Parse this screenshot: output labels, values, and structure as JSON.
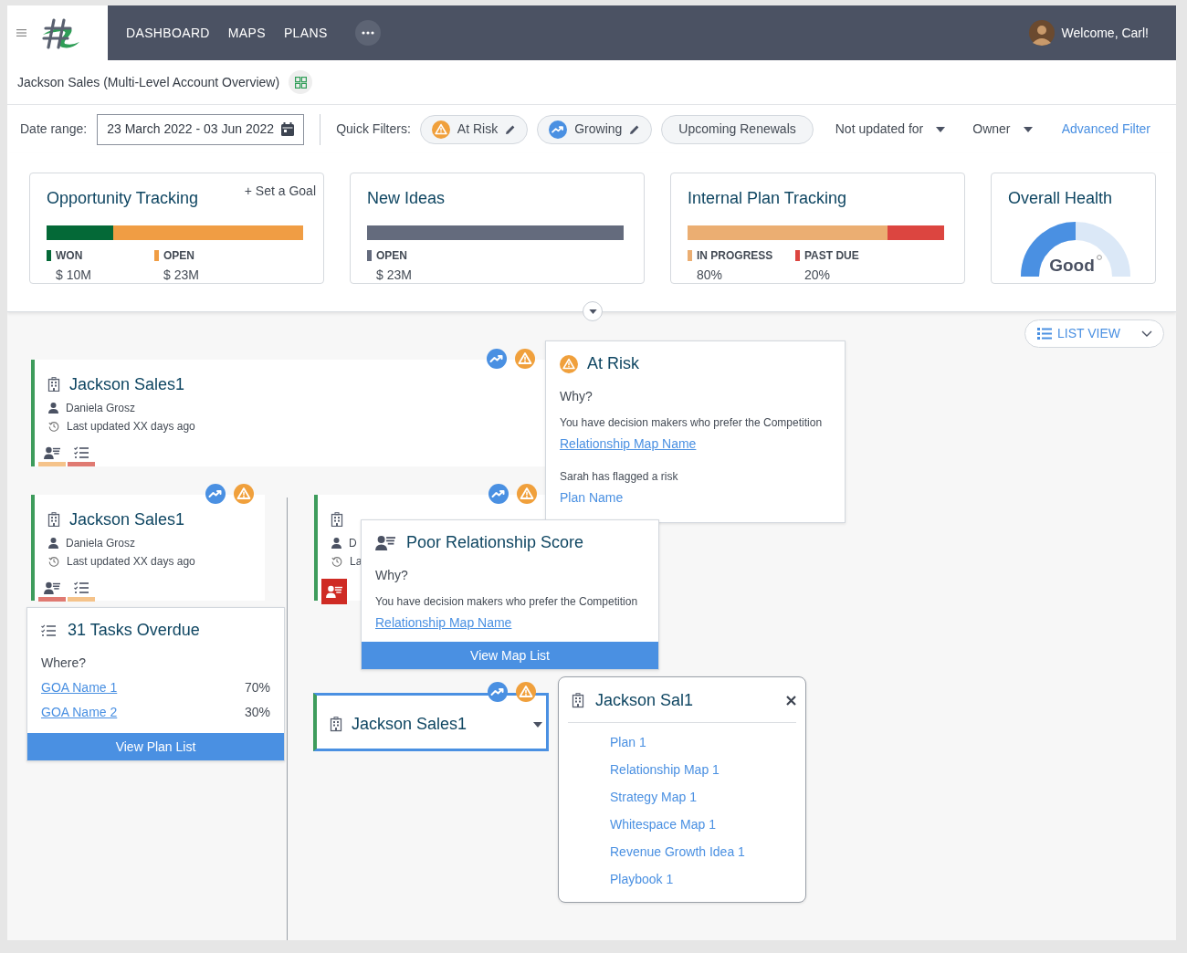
{
  "header": {
    "nav": [
      "DASHBOARD",
      "MAPS",
      "PLANS"
    ],
    "welcome": "Welcome, Carl!"
  },
  "page_title": "Jackson Sales (Multi-Level Account Overview)",
  "filters": {
    "date_label": "Date range:",
    "date_value": "23 March 2022 - 03 Jun 2022",
    "quick_label": "Quick Filters:",
    "quick": [
      {
        "label": "At Risk",
        "kind": "risk",
        "editable": true
      },
      {
        "label": "Growing",
        "kind": "growth",
        "editable": true
      },
      {
        "label": "Upcoming Renewals",
        "kind": "plain",
        "editable": false
      }
    ],
    "dropdowns": [
      "Not updated for",
      "Owner"
    ],
    "advanced": "Advanced Filter"
  },
  "summary_cards": [
    {
      "kind": "bar",
      "title": "Opportunity Tracking",
      "action": "+ Set a Goal",
      "segments": [
        {
          "label": "WON",
          "value": "$ 10M",
          "color": "#046937"
        },
        {
          "label": "OPEN",
          "value": "$ 23M",
          "color": "#f09d44"
        }
      ]
    },
    {
      "kind": "bar",
      "title": "New Ideas",
      "segments": [
        {
          "label": "OPEN",
          "value": "$ 23M",
          "color": "#646b7d"
        }
      ]
    },
    {
      "kind": "bar",
      "title": "Internal Plan Tracking",
      "segments": [
        {
          "label": "IN PROGRESS",
          "value": "80%",
          "color": "#ebae72"
        },
        {
          "label": "PAST DUE",
          "value": "20%",
          "color": "#dc4540"
        }
      ]
    },
    {
      "kind": "gauge",
      "title": "Overall Health",
      "value": "Good"
    }
  ],
  "view_switch": "LIST VIEW",
  "nodes": [
    {
      "kind": "full",
      "selected": false,
      "title": "Jackson Sales1",
      "owner": "Daniela Grosz",
      "updated": "Last updated XX days ago",
      "indicators": [
        {
          "kind": "relationship",
          "color": "#f5c38a",
          "active": false
        },
        {
          "kind": "tasks",
          "color": "#e07a72",
          "active": false
        }
      ]
    },
    {
      "kind": "full",
      "selected": false,
      "title": "Jackson Sales1",
      "owner": "Daniela Grosz",
      "updated": "Last updated XX days ago",
      "indicators": [
        {
          "kind": "relationship",
          "color": "#e07a72",
          "active": false
        },
        {
          "kind": "tasks",
          "color": "#f5c38a",
          "active": false
        }
      ]
    },
    {
      "kind": "full",
      "selected": false,
      "owner": "D",
      "updated": "La",
      "indicators": [
        {
          "kind": "relationship",
          "color": "#cf2b24",
          "active": true
        }
      ]
    },
    {
      "kind": "compact",
      "selected": true,
      "title": "Jackson Sales1"
    }
  ],
  "popovers": [
    {
      "kind": "risk",
      "title": "At Risk",
      "question": "Why?",
      "text": "You have decision makers who prefer the Competition",
      "link": "Relationship Map Name",
      "note": "Sarah has flagged a risk",
      "note_link": "Plan Name"
    },
    {
      "kind": "relationship",
      "title": "Poor Relationship Score",
      "question": "Why?",
      "text": "You have decision makers who prefer the Competition",
      "link": "Relationship Map Name",
      "button": "View Map List"
    },
    {
      "kind": "tasks",
      "title": "31 Tasks Overdue",
      "question": "Where?",
      "rows": [
        {
          "name": "GOA Name 1",
          "value": "70%"
        },
        {
          "name": "GOA Name 2",
          "value": "30%"
        }
      ],
      "button": "View Plan List"
    },
    {
      "kind": "menu",
      "title": "Jackson Sal1",
      "items": [
        "Plan 1",
        "Relationship Map 1",
        "Strategy Map 1",
        "Whitespace Map 1",
        "Revenue Growth Idea 1",
        "Playbook 1"
      ]
    }
  ]
}
